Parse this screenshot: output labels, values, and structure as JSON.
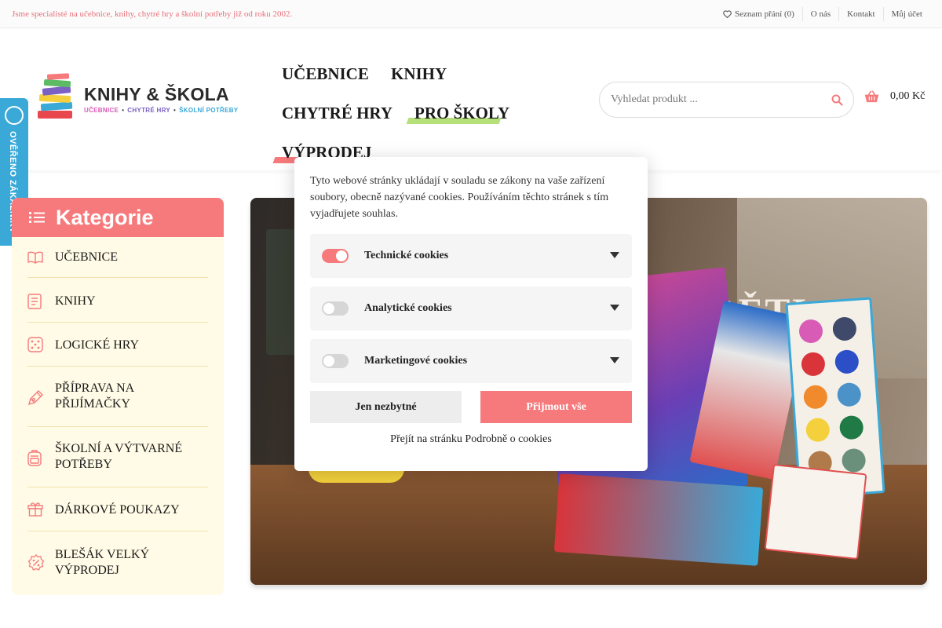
{
  "topbar": {
    "tagline": "Jsme specialisté na učebnice, knihy, chytré hry a školní potřeby již od roku 2002.",
    "wishlist": "Seznam přání (0)",
    "about": "O nás",
    "contact": "Kontakt",
    "account": "Můj účet"
  },
  "logo": {
    "title": "KNIHY & ŠKOLA",
    "sub1": "UČEBNICE",
    "sub2": "CHYTRÉ HRY",
    "sub3": "ŠKOLNÍ POTŘEBY"
  },
  "nav": {
    "textbooks": "UČEBNICE",
    "books": "KNIHY",
    "smart_games": "CHYTRÉ HRY",
    "for_schools": "PRO ŠKOLY",
    "sale": "VÝPRODEJ"
  },
  "search": {
    "placeholder": "Vyhledat produkt ..."
  },
  "cart": {
    "total": "0,00 Kč"
  },
  "badge": {
    "text": "OVĚŘENO ZÁKAZNÍKY"
  },
  "sidebar": {
    "title": "Kategorie",
    "items": [
      {
        "label": "UČEBNICE",
        "icon": "book-open-icon"
      },
      {
        "label": "KNIHY",
        "icon": "book-icon"
      },
      {
        "label": "LOGICKÉ HRY",
        "icon": "dice-icon"
      },
      {
        "label": "PŘÍPRAVA NA PŘIJÍMAČKY",
        "icon": "pen-icon"
      },
      {
        "label": "ŠKOLNÍ A VÝTVARNÉ POTŘEBY",
        "icon": "backpack-icon"
      },
      {
        "label": "DÁRKOVÉ POUKAZY",
        "icon": "gift-icon"
      },
      {
        "label": "BLEŠÁK VELKÝ VÝPRODEJ",
        "icon": "discount-icon"
      }
    ]
  },
  "banner": {
    "slogan": "RÉ DĚTI"
  },
  "cookies": {
    "message": "Tyto webové stránky ukládají v souladu se zákony na vaše zařízení soubory, obecně nazývané cookies. Používáním těchto stránek s tím vyjadřujete souhlas.",
    "categories": [
      {
        "name": "Technické cookies",
        "enabled": true
      },
      {
        "name": "Analytické cookies",
        "enabled": false
      },
      {
        "name": "Marketingové cookies",
        "enabled": false
      }
    ],
    "essential_button": "Jen nezbytné",
    "accept_button": "Přijmout vše",
    "details_link": "Přejít na stránku Podrobně o cookies"
  },
  "colors": {
    "accent": "#f67a7c",
    "sidebar_bg": "#fffbe6",
    "badge": "#3aa9d8",
    "green_highlight": "#b5e07a"
  }
}
